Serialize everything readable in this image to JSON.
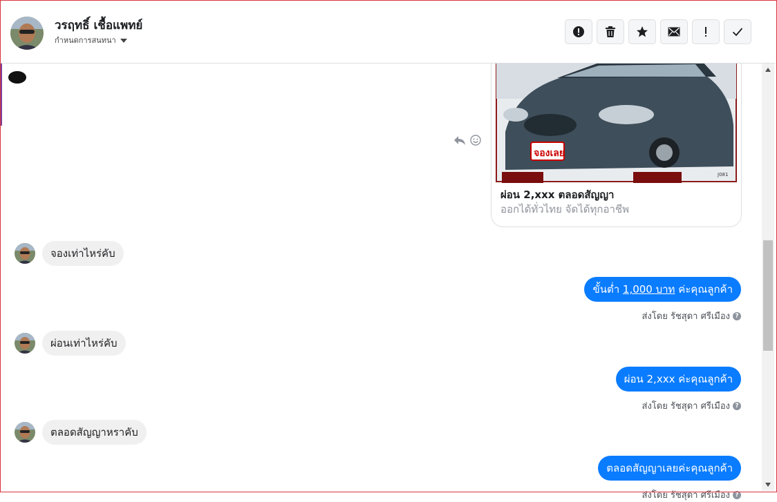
{
  "header": {
    "contact_name": "วรฤทธิ์ เชื้อแพทย์",
    "assign_label": "กำหนดการสนทนา",
    "toolbar": [
      {
        "icon": "spam-icon",
        "name": "mark-spam-button"
      },
      {
        "icon": "trash-icon",
        "name": "delete-button"
      },
      {
        "icon": "star-icon",
        "name": "star-button"
      },
      {
        "icon": "envelope-icon",
        "name": "mark-unread-button"
      },
      {
        "icon": "exclamation-icon",
        "name": "follow-up-button"
      },
      {
        "icon": "check-icon",
        "name": "mark-done-button"
      }
    ]
  },
  "card": {
    "title": "ผ่อน 2,xxx ตลอดสัญญา",
    "subtitle": "ออกได้ทั่วไทย จัดได้ทุกอาชีพ",
    "badge": "จองเลย",
    "code": "J081"
  },
  "messages": [
    {
      "dir": "in",
      "text": "จองเท่าไหร่คับ"
    },
    {
      "dir": "out",
      "pre": "ขั้นต่ำ ",
      "link": "1,000 บาท",
      "post": " ค่ะคุณลูกค้า",
      "sender": "ส่งโดย รัชสุดา ศรีเมือง"
    },
    {
      "dir": "in",
      "text": "ผ่อนเท่าไหร่คับ"
    },
    {
      "dir": "out",
      "text": "ผ่อน 2,xxx ค่ะคุณลูกค้า",
      "sender": "ส่งโดย รัชสุดา ศรีเมือง"
    },
    {
      "dir": "in",
      "text": "ตลอดสัญญาหราคับ"
    },
    {
      "dir": "out",
      "text": "ตลอดสัญญาเลยค่ะคุณลูกค้า",
      "sender": "ส่งโดย รัชสุดา ศรีเมือง"
    }
  ],
  "colors": {
    "outgoing_bubble": "#0a7cff",
    "incoming_bubble": "#f1f0f0",
    "frame_border": "#d8323c"
  }
}
